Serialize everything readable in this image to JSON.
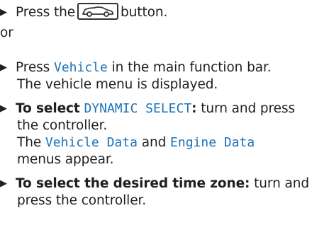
{
  "steps": [
    {
      "press_prefix": "Press the",
      "button_icon": "car-icon",
      "press_suffix": "button."
    }
  ],
  "or_label": "or",
  "step2": {
    "prefix": "Press",
    "menu_name": "Vehicle",
    "suffix": "in the main function bar.",
    "result": "The vehicle menu is displayed."
  },
  "step3": {
    "lead_bold": "To select",
    "option_name": "DYNAMIC SELECT",
    "colon": ":",
    "action": "turn and press",
    "action2": "the controller.",
    "result_prefix": "The",
    "menu1": "Vehicle Data",
    "and_word": "and",
    "menu2": "Engine Data",
    "result_suffix": "menus appear."
  },
  "step4": {
    "lead_bold": "To select the desired time zone:",
    "action": "turn and",
    "action2": "press the controller."
  },
  "colors": {
    "ui_text": "#1b72b8",
    "body_text": "#1f1f1f"
  }
}
